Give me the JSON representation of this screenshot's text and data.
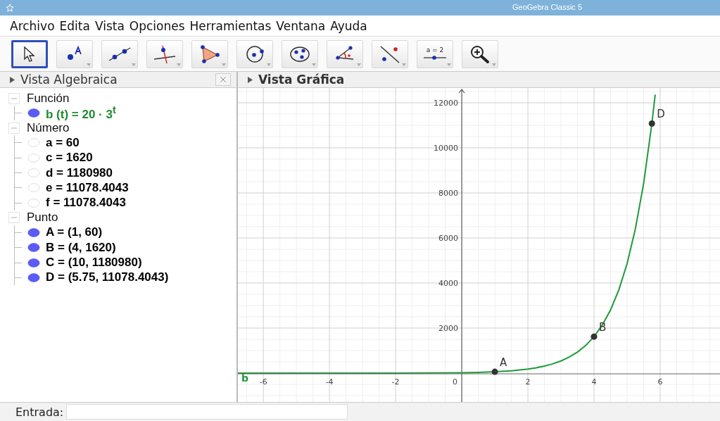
{
  "window": {
    "title": "GeoGebra Classic 5"
  },
  "menu": [
    "Archivo",
    "Edita",
    "Vista",
    "Opciones",
    "Herramientas",
    "Ventana",
    "Ayuda"
  ],
  "tools": [
    {
      "kind": "move",
      "selected": true
    },
    {
      "kind": "point",
      "selected": false
    },
    {
      "kind": "line",
      "selected": false
    },
    {
      "kind": "perpendicular",
      "selected": false
    },
    {
      "kind": "polygon",
      "selected": false
    },
    {
      "kind": "circle",
      "selected": false
    },
    {
      "kind": "conic",
      "selected": false
    },
    {
      "kind": "angle",
      "selected": false
    },
    {
      "kind": "reflect",
      "selected": false
    },
    {
      "kind": "slider",
      "selected": false,
      "label": "a = 2"
    },
    {
      "kind": "zoom",
      "selected": false
    }
  ],
  "algebra_view": {
    "title": "Vista Algebraica",
    "groups": [
      {
        "label": "Función",
        "expanded": true,
        "items": [
          {
            "text": "b (t) = 20 · 3$^{t}$",
            "visible": true,
            "color": "#1f8a2e"
          }
        ]
      },
      {
        "label": "Número",
        "expanded": true,
        "items": [
          {
            "text": "a = 60",
            "visible": false,
            "color": "#000000"
          },
          {
            "text": "c = 1620",
            "visible": false,
            "color": "#000000"
          },
          {
            "text": "d = 1180980",
            "visible": false,
            "color": "#000000"
          },
          {
            "text": "e = 11078.4043",
            "visible": false,
            "color": "#000000"
          },
          {
            "text": "f = 11078.4043",
            "visible": false,
            "color": "#000000"
          }
        ]
      },
      {
        "label": "Punto",
        "expanded": true,
        "items": [
          {
            "text": "A = (1, 60)",
            "visible": true,
            "color": "#000000"
          },
          {
            "text": "B = (4, 1620)",
            "visible": true,
            "color": "#000000"
          },
          {
            "text": "C = (10, 1180980)",
            "visible": true,
            "color": "#000000"
          },
          {
            "text": "D = (5.75, 11078.4043)",
            "visible": true,
            "color": "#000000"
          }
        ]
      }
    ]
  },
  "graphics_view": {
    "title": "Vista Gráfica",
    "chart_data": {
      "type": "line",
      "x": [
        -6.77,
        -2,
        0,
        0.5,
        1,
        1.5,
        2,
        2.25,
        2.5,
        2.75,
        3,
        3.25,
        3.5,
        3.75,
        4,
        4.25,
        4.5,
        4.75,
        5,
        5.25,
        5.5,
        5.75,
        5.85
      ],
      "series": [
        {
          "name": "b",
          "color": "#1f9a3a",
          "values": [
            0,
            2,
            20,
            35,
            60,
            104,
            180,
            237,
            312,
            410,
            540,
            711,
            935,
            1231,
            1620,
            2132,
            2806,
            3693,
            4860,
            6396,
            8418,
            11078,
            12361
          ]
        }
      ],
      "xlim": [
        -6.77,
        7.81
      ],
      "ylim": [
        -1344,
        12656
      ],
      "grid": true,
      "xticks": [
        -6,
        -4,
        -2,
        2,
        4,
        6
      ],
      "yticks": [
        2000,
        4000,
        6000,
        8000,
        10000,
        12000
      ],
      "annotations": [
        {
          "text": "A",
          "x": 1,
          "y": 60
        },
        {
          "text": "B",
          "x": 4,
          "y": 1620
        },
        {
          "text": "D",
          "x": 5.75,
          "y": 11078.4043
        }
      ]
    },
    "origin_label": "0"
  },
  "input_bar": {
    "label": "Entrada:"
  }
}
